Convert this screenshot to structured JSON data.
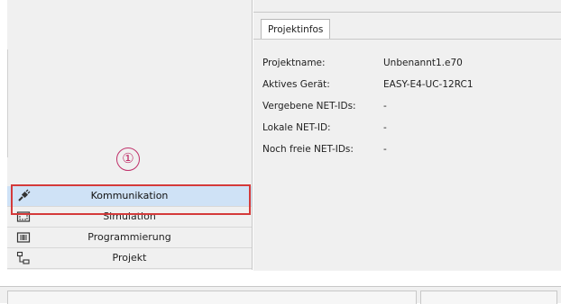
{
  "nav": {
    "marker": "①",
    "items": [
      {
        "label": "Kommunikation",
        "icon": "connection-plug-icon"
      },
      {
        "label": "Simulation",
        "icon": "simulation-icon"
      },
      {
        "label": "Programmierung",
        "icon": "programming-icon"
      },
      {
        "label": "Projekt",
        "icon": "project-tree-icon"
      }
    ]
  },
  "tab": {
    "label": "Projektinfos"
  },
  "info": [
    {
      "label": "Projektname:",
      "value": "Unbenannt1.e70"
    },
    {
      "label": "Aktives Gerät:",
      "value": "EASY-E4-UC-12RC1"
    },
    {
      "label": "Vergebene NET-IDs:",
      "value": "-"
    },
    {
      "label": "Lokale NET-ID:",
      "value": "-"
    },
    {
      "label": "Noch freie NET-IDs:",
      "value": "-"
    }
  ],
  "colors": {
    "highlight": "#d43a3a",
    "marker": "#c0306a",
    "active_item": "#cfe2f6"
  }
}
